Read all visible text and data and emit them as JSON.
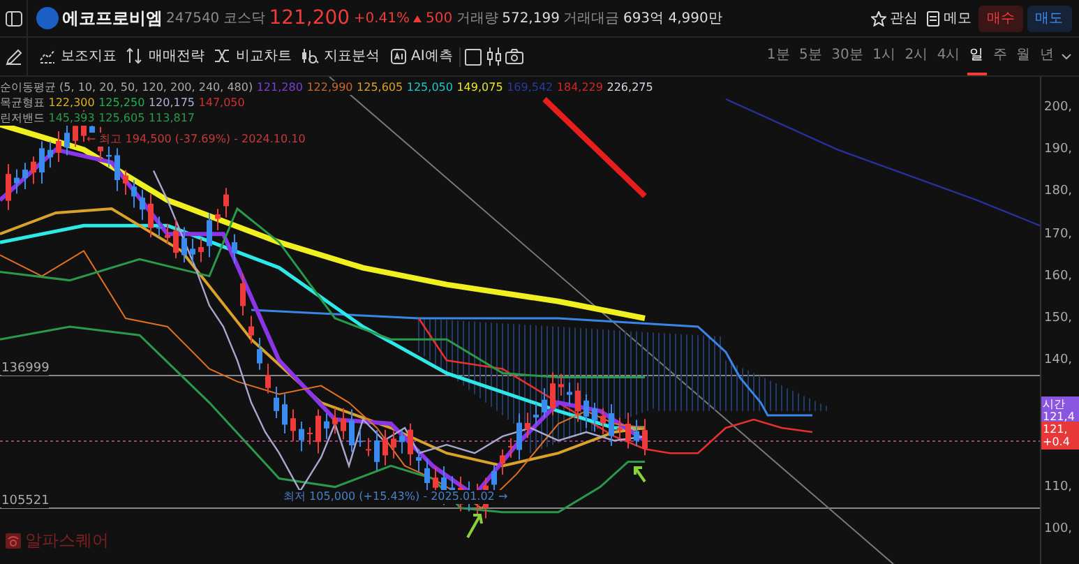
{
  "header": {
    "name": "에코프로비엠",
    "code": "247540",
    "market": "코스닥",
    "price": "121,200",
    "change_pct": "+0.41%",
    "change_abs": "500",
    "volume_label": "거래량",
    "volume": "572,199",
    "turnover_label": "거래대금",
    "turnover": "693억 4,990만",
    "actions": [
      {
        "kind": "star",
        "label": "관심"
      },
      {
        "kind": "memo",
        "label": "메모"
      }
    ],
    "buy": "매수",
    "sell": "매도"
  },
  "toolbar": {
    "tools": [
      {
        "kind": "indicator",
        "label": "보조지표"
      },
      {
        "kind": "strategy",
        "label": "매매전략"
      },
      {
        "kind": "compare",
        "label": "비교차트"
      },
      {
        "kind": "analysis",
        "label": "지표분석"
      },
      {
        "kind": "ai",
        "label": "AI예측"
      }
    ],
    "timeframes": [
      {
        "label": "1분",
        "selected": false
      },
      {
        "label": "5분",
        "selected": false
      },
      {
        "label": "30분",
        "selected": false
      },
      {
        "label": "1시",
        "selected": false
      },
      {
        "label": "2시",
        "selected": false
      },
      {
        "label": "4시",
        "selected": false
      },
      {
        "label": "일",
        "selected": true
      },
      {
        "label": "주",
        "selected": false
      },
      {
        "label": "월",
        "selected": false
      },
      {
        "label": "년",
        "selected": false
      }
    ]
  },
  "chart": {
    "legend": [
      {
        "name": "순이동평균",
        "params": "(5, 10, 20, 50, 120, 200, 240, 480)",
        "values": [
          {
            "text": "121,280",
            "color": "#7a3fd6"
          },
          {
            "text": "122,990",
            "color": "#c8682a"
          },
          {
            "text": "125,605",
            "color": "#d9a22a"
          },
          {
            "text": "125,050",
            "color": "#22c8c8"
          },
          {
            "text": "149,075",
            "color": "#e6e62a"
          },
          {
            "text": "169,542",
            "color": "#2a3aa0"
          },
          {
            "text": "184,229",
            "color": "#d02828"
          },
          {
            "text": "226,275",
            "color": "#d8d8e8"
          }
        ]
      },
      {
        "name": "목균형표",
        "values": [
          {
            "text": "122,300",
            "color": "#d8b020"
          },
          {
            "text": "125,250",
            "color": "#22b050"
          },
          {
            "text": "120,175",
            "color": "#b0b0d8"
          },
          {
            "text": "147,050",
            "color": "#d03030"
          }
        ]
      },
      {
        "name": "린저밴드",
        "values": [
          {
            "text": "145,393",
            "color": "#2a9a4a"
          },
          {
            "text": "125,605",
            "color": "#2a9a4a"
          },
          {
            "text": "113,817",
            "color": "#2a9a4a"
          }
        ]
      }
    ],
    "high_note": "← 최고 194,500 (-37.69%) - 2024.10.10",
    "low_note": "최저 105,000 (+15.43%) - 2025.01.02 →",
    "levels": [
      "136999",
      "105521"
    ],
    "axis": [
      "200,",
      "190,",
      "180,",
      "170,",
      "160,",
      "150,",
      "140,",
      "110,",
      "100,"
    ],
    "tags": [
      {
        "kind": "after-hours",
        "lines": [
          "시간",
          "121,4"
        ]
      },
      {
        "kind": "current",
        "lines": [
          "121,",
          "+0.4"
        ]
      }
    ],
    "watermark": "알파스퀘어"
  }
}
